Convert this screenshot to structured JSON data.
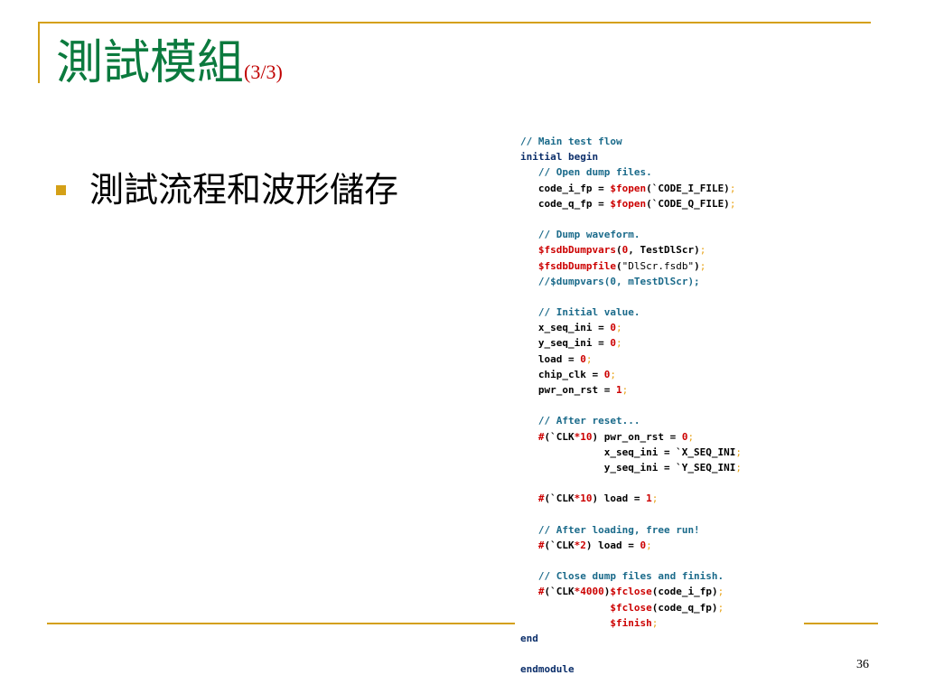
{
  "slide": {
    "title_main": "測試模組",
    "title_sub": "(3/3)",
    "bullets": [
      "測試流程和波形儲存"
    ],
    "page_number": "36"
  },
  "colors": {
    "accent_gold": "#d4a017",
    "title_green": "#0b7a3e",
    "subtitle_red": "#c00000",
    "code_comment": "#1a6a8a",
    "code_keyword": "#0b2e6a",
    "code_sysfunc": "#cc0000",
    "code_semicolon": "#e8a317"
  },
  "code_lines": [
    [
      [
        "comment",
        "// Main test flow"
      ]
    ],
    [
      [
        "keyword",
        "initial begin"
      ]
    ],
    [
      [
        "plain",
        "   "
      ],
      [
        "comment",
        "// Open dump files."
      ]
    ],
    [
      [
        "plain",
        "   code_i_fp = "
      ],
      [
        "sysfunc",
        "$fopen"
      ],
      [
        "plain",
        "(`CODE_I_FILE)"
      ],
      [
        "semi",
        ";"
      ]
    ],
    [
      [
        "plain",
        "   code_q_fp = "
      ],
      [
        "sysfunc",
        "$fopen"
      ],
      [
        "plain",
        "(`CODE_Q_FILE)"
      ],
      [
        "semi",
        ";"
      ]
    ],
    [
      [
        "plain",
        ""
      ]
    ],
    [
      [
        "plain",
        "   "
      ],
      [
        "comment",
        "// Dump waveform."
      ]
    ],
    [
      [
        "plain",
        "   "
      ],
      [
        "sysfunc",
        "$fsdbDumpvars"
      ],
      [
        "plain",
        "("
      ],
      [
        "number",
        "0"
      ],
      [
        "plain",
        ", TestDlScr)"
      ],
      [
        "semi",
        ";"
      ]
    ],
    [
      [
        "plain",
        "   "
      ],
      [
        "sysfunc",
        "$fsdbDumpfile"
      ],
      [
        "plain",
        "("
      ],
      [
        "string",
        "\"DlScr.fsdb\""
      ],
      [
        "plain",
        ")"
      ],
      [
        "semi",
        ";"
      ]
    ],
    [
      [
        "plain",
        "   "
      ],
      [
        "comment",
        "//$dumpvars(0, mTestDlScr);"
      ]
    ],
    [
      [
        "plain",
        ""
      ]
    ],
    [
      [
        "plain",
        "   "
      ],
      [
        "comment",
        "// Initial value."
      ]
    ],
    [
      [
        "plain",
        "   x_seq_ini = "
      ],
      [
        "number",
        "0"
      ],
      [
        "semi",
        ";"
      ]
    ],
    [
      [
        "plain",
        "   y_seq_ini = "
      ],
      [
        "number",
        "0"
      ],
      [
        "semi",
        ";"
      ]
    ],
    [
      [
        "plain",
        "   load = "
      ],
      [
        "number",
        "0"
      ],
      [
        "semi",
        ";"
      ]
    ],
    [
      [
        "plain",
        "   chip_clk = "
      ],
      [
        "number",
        "0"
      ],
      [
        "semi",
        ";"
      ]
    ],
    [
      [
        "plain",
        "   pwr_on_rst = "
      ],
      [
        "number",
        "1"
      ],
      [
        "semi",
        ";"
      ]
    ],
    [
      [
        "plain",
        ""
      ]
    ],
    [
      [
        "plain",
        "   "
      ],
      [
        "comment",
        "// After reset..."
      ]
    ],
    [
      [
        "plain",
        "   "
      ],
      [
        "sysfunc",
        "#"
      ],
      [
        "plain",
        "(`CLK"
      ],
      [
        "sysfunc",
        "*10"
      ],
      [
        "plain",
        ") pwr_on_rst = "
      ],
      [
        "number",
        "0"
      ],
      [
        "semi",
        ";"
      ]
    ],
    [
      [
        "plain",
        "              x_seq_ini = `X_SEQ_INI"
      ],
      [
        "semi",
        ";"
      ]
    ],
    [
      [
        "plain",
        "              y_seq_ini = `Y_SEQ_INI"
      ],
      [
        "semi",
        ";"
      ]
    ],
    [
      [
        "plain",
        ""
      ]
    ],
    [
      [
        "plain",
        "   "
      ],
      [
        "sysfunc",
        "#"
      ],
      [
        "plain",
        "(`CLK"
      ],
      [
        "sysfunc",
        "*10"
      ],
      [
        "plain",
        ") load = "
      ],
      [
        "number",
        "1"
      ],
      [
        "semi",
        ";"
      ]
    ],
    [
      [
        "plain",
        ""
      ]
    ],
    [
      [
        "plain",
        "   "
      ],
      [
        "comment",
        "// After loading, free run!"
      ]
    ],
    [
      [
        "plain",
        "   "
      ],
      [
        "sysfunc",
        "#"
      ],
      [
        "plain",
        "(`CLK"
      ],
      [
        "sysfunc",
        "*2"
      ],
      [
        "plain",
        ") load = "
      ],
      [
        "number",
        "0"
      ],
      [
        "semi",
        ";"
      ]
    ],
    [
      [
        "plain",
        ""
      ]
    ],
    [
      [
        "plain",
        "   "
      ],
      [
        "comment",
        "// Close dump files and finish."
      ]
    ],
    [
      [
        "plain",
        "   "
      ],
      [
        "sysfunc",
        "#"
      ],
      [
        "plain",
        "(`CLK"
      ],
      [
        "sysfunc",
        "*4000"
      ],
      [
        "plain",
        ")"
      ],
      [
        "sysfunc",
        "$fclose"
      ],
      [
        "plain",
        "(code_i_fp)"
      ],
      [
        "semi",
        ";"
      ]
    ],
    [
      [
        "plain",
        "               "
      ],
      [
        "sysfunc",
        "$fclose"
      ],
      [
        "plain",
        "(code_q_fp)"
      ],
      [
        "semi",
        ";"
      ]
    ],
    [
      [
        "plain",
        "               "
      ],
      [
        "sysfunc",
        "$finish"
      ],
      [
        "semi",
        ";"
      ]
    ],
    [
      [
        "keyword",
        "end"
      ]
    ],
    [
      [
        "plain",
        ""
      ]
    ],
    [
      [
        "keyword",
        "endmodule"
      ]
    ]
  ]
}
